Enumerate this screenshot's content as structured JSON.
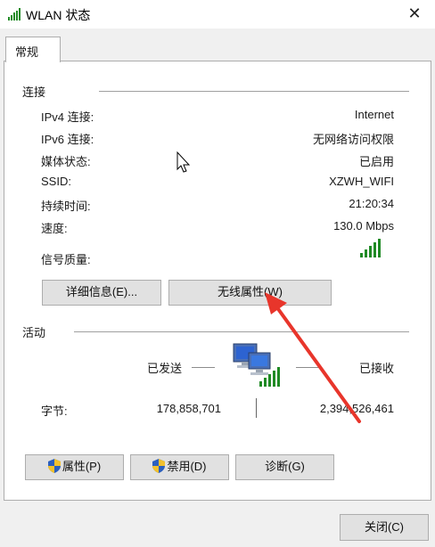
{
  "window": {
    "title": "WLAN 状态",
    "close_icon": "✕"
  },
  "tabs": [
    {
      "label": "常规"
    }
  ],
  "connection": {
    "section_label": "连接",
    "rows": [
      {
        "label": "IPv4 连接:",
        "value": "Internet"
      },
      {
        "label": "IPv6 连接:",
        "value": "无网络访问权限"
      },
      {
        "label": "媒体状态:",
        "value": "已启用"
      },
      {
        "label": "SSID:",
        "value": "XZWH_WIFI"
      },
      {
        "label": "持续时间:",
        "value": "21:20:34"
      },
      {
        "label": "速度:",
        "value": "130.0 Mbps"
      }
    ],
    "signal_label": "信号质量:",
    "signal_bars": 5,
    "signal_icon": "signal-strength-icon",
    "details_button": "详细信息(E)...",
    "wireless_props_button": "无线属性(W)"
  },
  "activity": {
    "section_label": "活动",
    "sent_label": "已发送",
    "received_label": "已接收",
    "bytes_label": "字节:",
    "bytes_sent": "178,858,701",
    "bytes_received": "2,394,526,461",
    "network_icon": "network-computers-icon"
  },
  "actions": {
    "properties": "属性(P)",
    "disable": "禁用(D)",
    "diagnose": "诊断(G)"
  },
  "footer": {
    "close": "关闭(C)"
  },
  "colors": {
    "accent_arrow": "#e8352b",
    "signal_green": "#1f8a24"
  }
}
